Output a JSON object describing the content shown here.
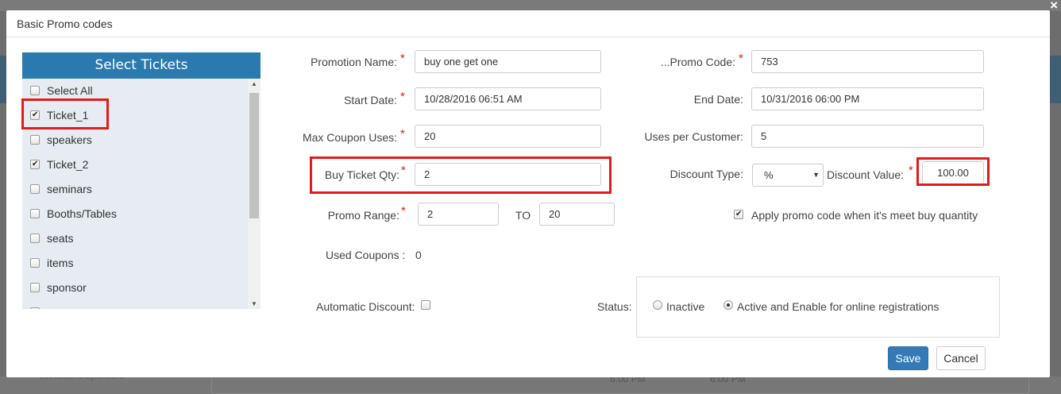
{
  "background": {
    "link": "Exhibitors/Sponsors",
    "cells": [
      "6:00 PM",
      "6:00 PM"
    ]
  },
  "modal": {
    "title": "Basic Promo codes",
    "close_glyph": "×"
  },
  "tickets": {
    "header": "Select Tickets",
    "items": [
      {
        "label": "Select All",
        "checked": false
      },
      {
        "label": "Ticket_1",
        "checked": true
      },
      {
        "label": "speakers",
        "checked": false
      },
      {
        "label": "Ticket_2",
        "checked": true
      },
      {
        "label": "seminars",
        "checked": false
      },
      {
        "label": "Booths/Tables",
        "checked": false
      },
      {
        "label": "seats",
        "checked": false
      },
      {
        "label": "items",
        "checked": false
      },
      {
        "label": "sponsor",
        "checked": false
      },
      {
        "label": "",
        "checked": false
      }
    ]
  },
  "form": {
    "promotion_name": {
      "label": "Promotion Name:",
      "value": "buy one get one"
    },
    "promo_code": {
      "label": "...Promo Code:",
      "value": "753"
    },
    "start_date": {
      "label": "Start Date:",
      "value": "10/28/2016 06:51 AM"
    },
    "end_date": {
      "label": "End Date:",
      "value": "10/31/2016 06:00 PM"
    },
    "max_coupon_uses": {
      "label": "Max Coupon Uses:",
      "value": "20"
    },
    "uses_per_customer": {
      "label": "Uses per Customer:",
      "value": "5"
    },
    "buy_ticket_qty": {
      "label": "Buy Ticket Qty:",
      "value": "2"
    },
    "discount_type": {
      "label": "Discount Type:",
      "value": "%"
    },
    "discount_value": {
      "label": "Discount Value:",
      "value": "100.00"
    },
    "promo_range": {
      "label": "Promo Range:",
      "from": "2",
      "to_label": "TO",
      "to": "20"
    },
    "apply_promo": {
      "label": "Apply promo code when it's meet buy quantity",
      "checked": true
    },
    "used_coupons": {
      "label": "Used Coupons :",
      "value": "0"
    },
    "automatic_discount": {
      "label": "Automatic Discount:",
      "checked": false
    },
    "status": {
      "label": "Status:",
      "options": [
        {
          "label": "Inactive",
          "selected": false
        },
        {
          "label": "Active and Enable for online registrations",
          "selected": true
        }
      ]
    }
  },
  "buttons": {
    "save": "Save",
    "cancel": "Cancel"
  },
  "required_marker": "*",
  "colors": {
    "primary": "#337ab7",
    "header": "#2a7aaf",
    "highlight": "#e31b1b",
    "list_bg": "#e6ecf1"
  }
}
